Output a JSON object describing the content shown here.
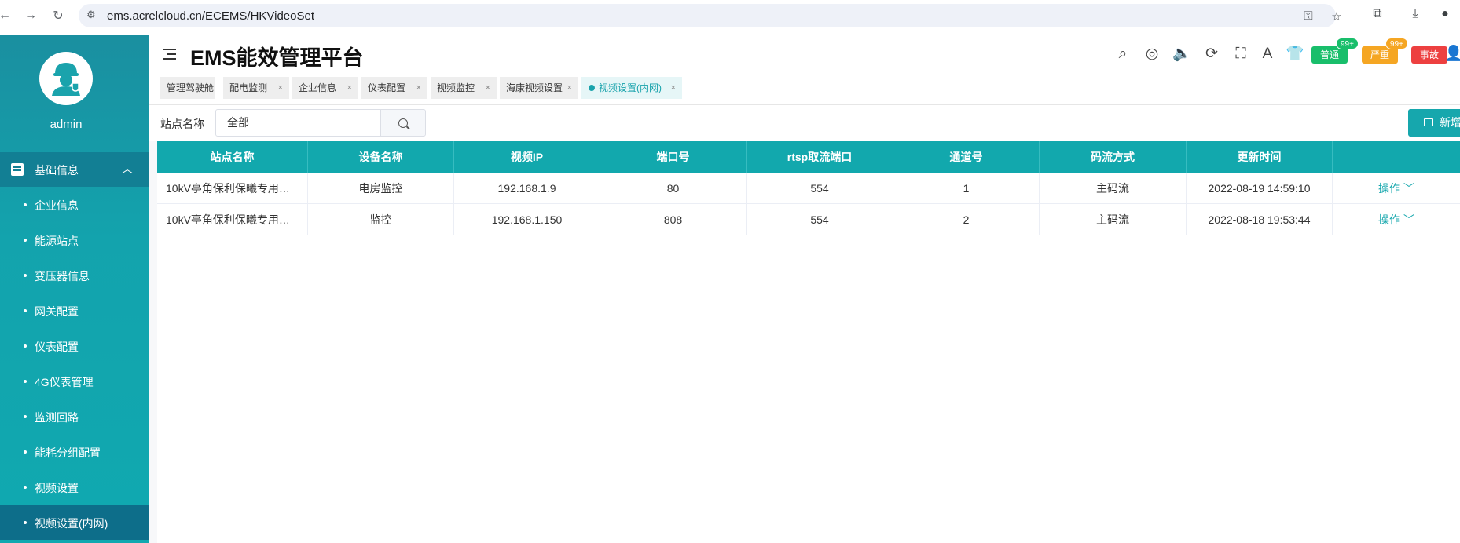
{
  "browser": {
    "url": "ems.acrelcloud.cn/ECEMS/HKVideoSet"
  },
  "sidebar": {
    "username": "admin",
    "group_label": "基础信息",
    "items": [
      {
        "label": "企业信息"
      },
      {
        "label": "能源站点"
      },
      {
        "label": "变压器信息"
      },
      {
        "label": "网关配置"
      },
      {
        "label": "仪表配置"
      },
      {
        "label": "4G仪表管理"
      },
      {
        "label": "监测回路"
      },
      {
        "label": "能耗分组配置"
      },
      {
        "label": "视频设置"
      },
      {
        "label": "视频设置(内网)"
      }
    ]
  },
  "header": {
    "title": "EMS能效管理平台",
    "alarms": [
      {
        "label": "普通",
        "badge": "99+",
        "color": "#19be6b"
      },
      {
        "label": "严重",
        "badge": "99+",
        "color": "#f5a623"
      },
      {
        "label": "事故",
        "color": "#ed4040"
      }
    ]
  },
  "tabs": [
    {
      "label": "管理驾驶舱"
    },
    {
      "label": "配电监测",
      "close": "×"
    },
    {
      "label": "企业信息",
      "close": "×"
    },
    {
      "label": "仪表配置",
      "close": "×"
    },
    {
      "label": "视频监控",
      "close": "×"
    },
    {
      "label": "海康视频设置",
      "close": "×"
    },
    {
      "label": "视频设置(内网)",
      "close": "×"
    }
  ],
  "filter": {
    "label": "站点名称",
    "value": "全部",
    "add_label": "新增"
  },
  "table": {
    "headers": [
      "站点名称",
      "设备名称",
      "视频IP",
      "端口号",
      "rtsp取流端口",
      "通道号",
      "码流方式",
      "更新时间"
    ],
    "rows": [
      [
        "10kV亭角保利保曦专用…",
        "电房监控",
        "192.168.1.9",
        "80",
        "554",
        "1",
        "主码流",
        "2022-08-19 14:59:10",
        "操作"
      ],
      [
        "10kV亭角保利保曦专用…",
        "监控",
        "192.168.1.150",
        "808",
        "554",
        "2",
        "主码流",
        "2022-08-18 19:53:44",
        "操作"
      ]
    ]
  },
  "colors": {
    "accent": "#12a8ad",
    "sidebar_active": "#0d6e8a"
  }
}
